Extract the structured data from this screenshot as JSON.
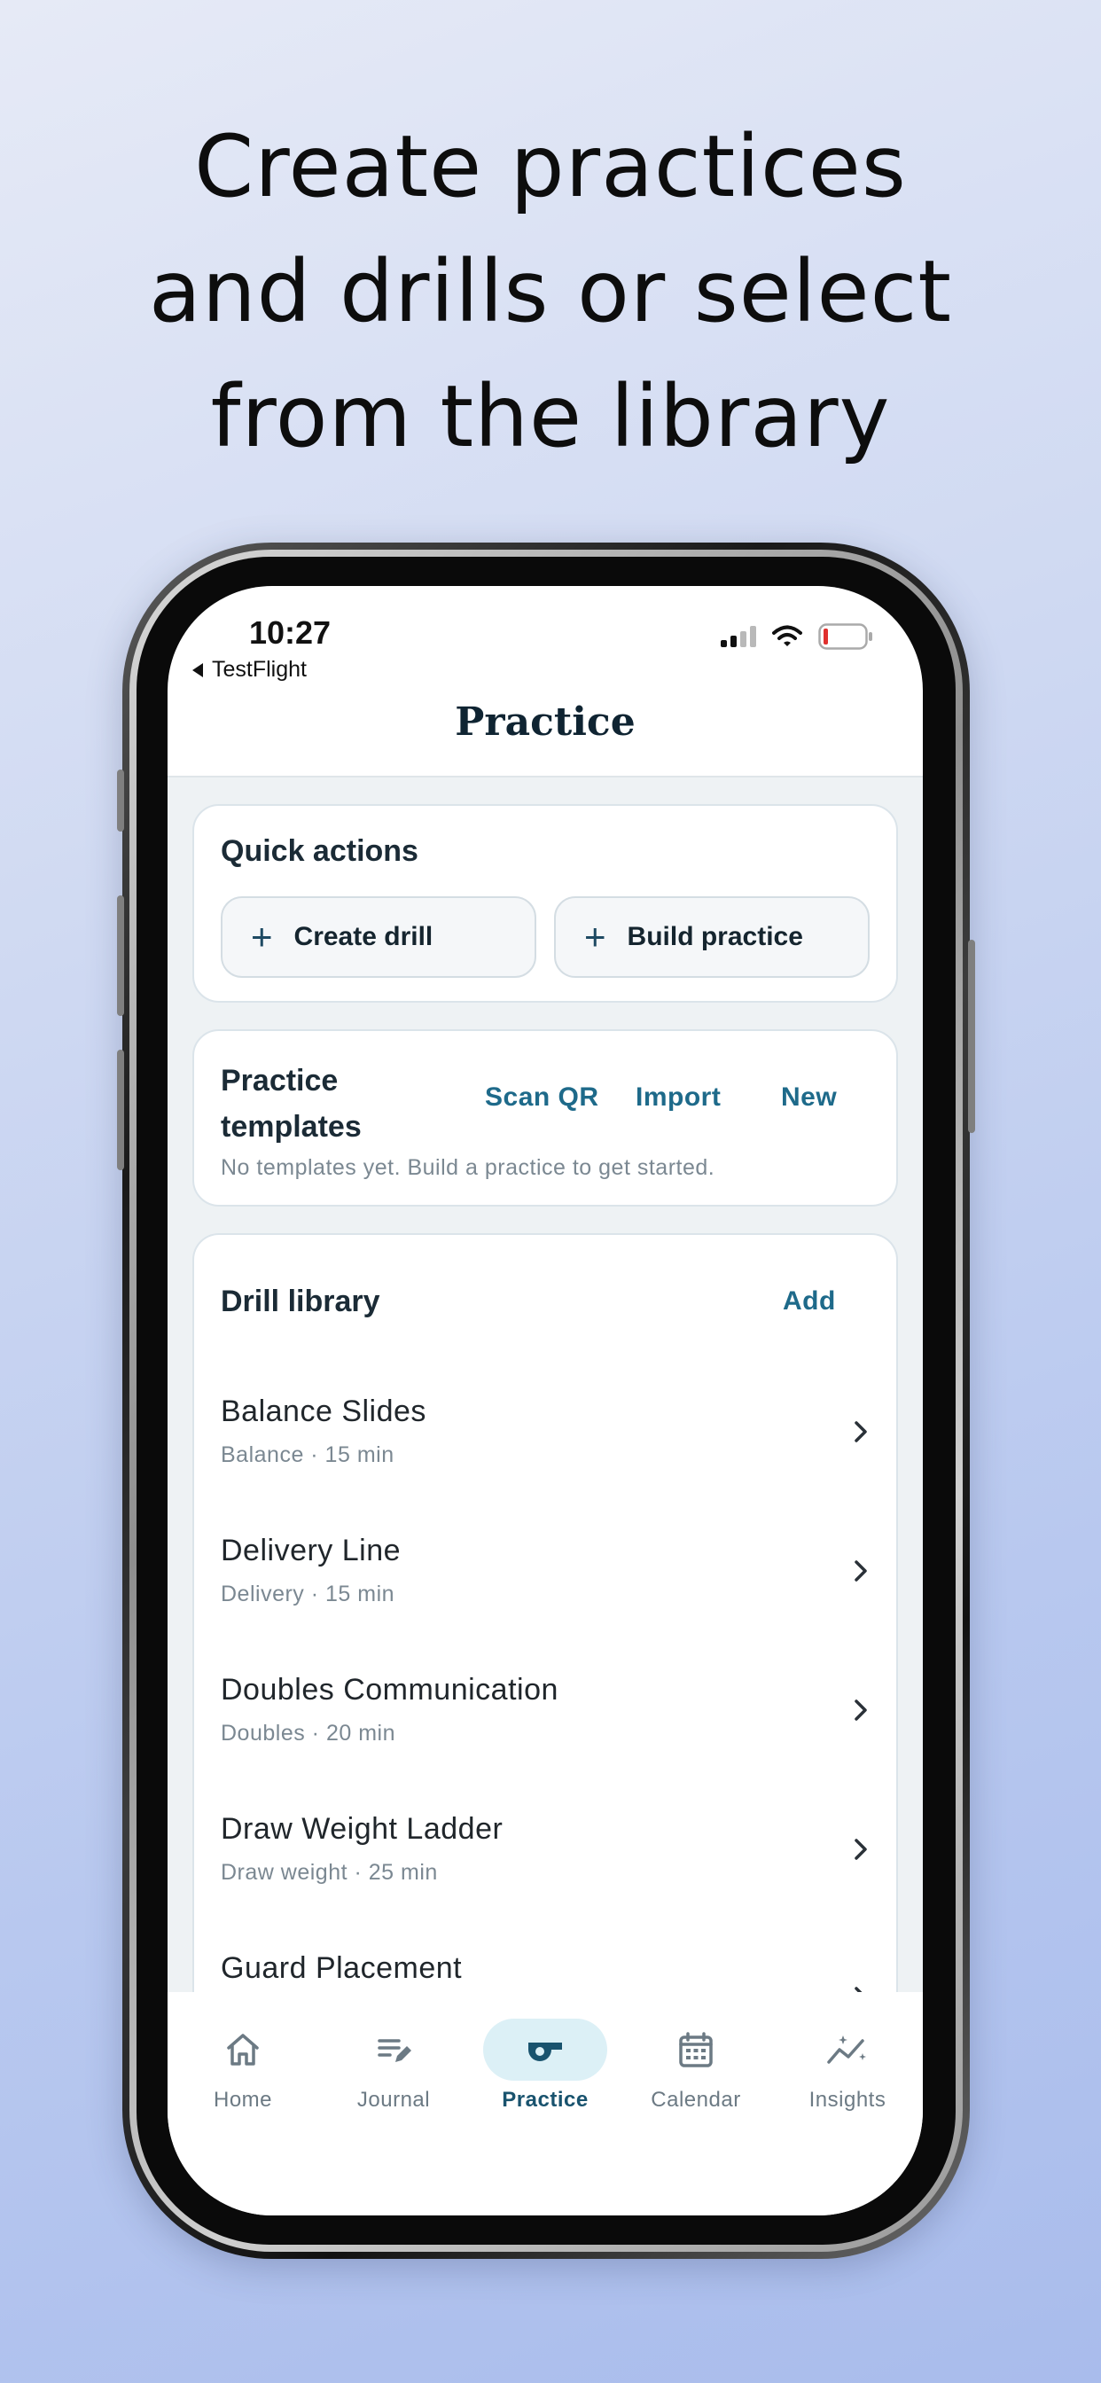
{
  "headline": {
    "line1": "Create practices",
    "line2": "and drills or select",
    "line3": "from the library"
  },
  "status_bar": {
    "time": "10:27",
    "back_label": "TestFlight"
  },
  "nav": {
    "title": "Practice"
  },
  "quick_actions": {
    "title": "Quick actions",
    "create_drill": "Create drill",
    "build_practice": "Build practice"
  },
  "practice_templates": {
    "title_line1": "Practice",
    "title_line2": "templates",
    "scan_qr": "Scan QR",
    "import": "Import",
    "new": "New",
    "empty_text": "No templates yet. Build a practice to get started."
  },
  "drill_library": {
    "title": "Drill library",
    "add": "Add",
    "items": [
      {
        "name": "Balance Slides",
        "meta": "Balance · 15 min"
      },
      {
        "name": "Delivery Line",
        "meta": "Delivery · 15 min"
      },
      {
        "name": "Doubles Communication",
        "meta": "Doubles · 20 min"
      },
      {
        "name": "Draw Weight Ladder",
        "meta": "Draw weight · 25 min"
      },
      {
        "name": "Guard Placement",
        "meta": ""
      }
    ]
  },
  "tabs": [
    {
      "label": "Home",
      "icon": "home-icon"
    },
    {
      "label": "Journal",
      "icon": "journal-icon"
    },
    {
      "label": "Practice",
      "icon": "whistle-icon",
      "active": true
    },
    {
      "label": "Calendar",
      "icon": "calendar-icon"
    },
    {
      "label": "Insights",
      "icon": "insights-icon"
    }
  ],
  "colors": {
    "accent": "#1e6a8a",
    "active_tab_bg": "#dcf0f6",
    "battery_low": "#e0302e"
  }
}
